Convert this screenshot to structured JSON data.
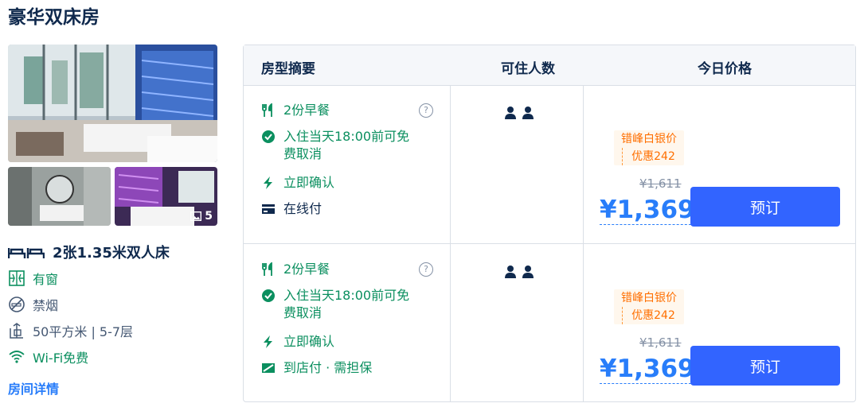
{
  "room": {
    "title": "豪华双床房",
    "photo_count": "5",
    "bed": "2张1.35米双人床",
    "facilities": [
      "有窗",
      "禁烟",
      "50平方米 | 5-7层",
      "Wi-Fi免费"
    ],
    "detail_link": "房间详情"
  },
  "table": {
    "headers": [
      "房型摘要",
      "可住人数",
      "今日价格"
    ],
    "rows": [
      {
        "breakfast": "2份早餐",
        "cancel": "入住当天18:00前可免费取消",
        "cancel_line1": "入住当天18:00前可免",
        "cancel_line2": "费取消",
        "confirm": "立即确认",
        "payment": "在线付",
        "help": "?",
        "promo_line1": "错峰白银价",
        "promo_line2": "优惠242",
        "original_price": "¥1,611",
        "price": "¥1,369",
        "book": "预订"
      },
      {
        "breakfast": "2份早餐",
        "cancel": "入住当天18:00前可免费取消",
        "cancel_line1": "入住当天18:00前可免",
        "cancel_line2": "费取消",
        "confirm": "立即确认",
        "payment": "到店付 · 需担保",
        "help": "?",
        "promo_line1": "错峰白银价",
        "promo_line2": "优惠242",
        "original_price": "¥1,611",
        "price": "¥1,369",
        "book": "预订"
      }
    ]
  },
  "colors": {
    "green": "#0b8f5f",
    "blue": "#287dfa",
    "button": "#3264ff",
    "promo": "#ff6f00"
  },
  "icons": [
    "bed-icon",
    "window-icon",
    "no-smoking-icon",
    "area-icon",
    "wifi-icon",
    "fork-knife-icon",
    "check-circle-icon",
    "lightning-icon",
    "card-icon",
    "pay-at-hotel-icon",
    "person-icon",
    "image-icon"
  ]
}
